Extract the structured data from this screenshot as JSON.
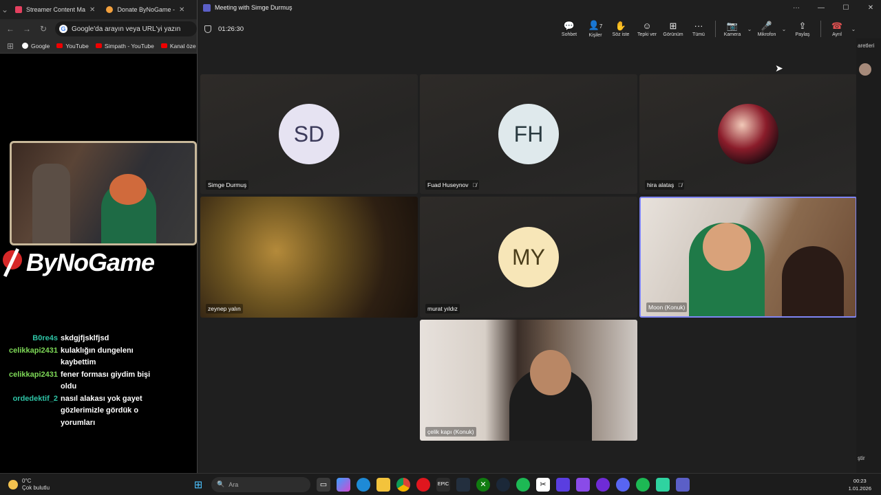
{
  "browser": {
    "tabs": [
      {
        "label": "Streamer Content Ma",
        "color": "#e4405f"
      },
      {
        "label": "Donate ByNoGame -",
        "color": "#f2a03d"
      }
    ],
    "url_placeholder": "Google'da arayın veya URL'yi yazın",
    "bookmarks": [
      "Google",
      "YouTube",
      "Simpath - YouTube",
      "Kanal öze"
    ]
  },
  "overlay": {
    "brand": "ByNoGame",
    "chat": [
      {
        "user": "B0re4s",
        "msg": "skdgjfjsklfjsd",
        "color": "#2ec4a6"
      },
      {
        "user": "celikkapi2431",
        "msg": "kulaklığın dungelenı kaybettim",
        "color": "#7ed957"
      },
      {
        "user": "celikkapi2431",
        "msg": "fener forması giydim bişi oldu",
        "color": "#7ed957"
      },
      {
        "user": "ordedektif_2",
        "msg": "nasıl alakası yok gayet gözlerimizle gördük o yorumları",
        "color": "#2ec4a6"
      }
    ]
  },
  "meeting": {
    "title": "Meeting with Simge Durmuş",
    "timer": "01:26:30",
    "toolbar": {
      "chat": "Sohbet",
      "people": "Kişiler",
      "people_count": "7",
      "raise_hand": "Söz iste",
      "react": "Tepki ver",
      "view": "Görünüm",
      "more": "Tümü",
      "camera": "Kamera",
      "mic": "Mikrofon",
      "share": "Paylaş",
      "leave": "Ayrıl"
    },
    "participants": [
      {
        "name": "Simge Durmuş",
        "initials": "SD",
        "avatar_color": "#e6e3f2"
      },
      {
        "name": "Fuad Huseynov",
        "initials": "FH",
        "avatar_color": "#dfe9ec"
      },
      {
        "name": "hira alataş"
      },
      {
        "name": "zeynep yalın"
      },
      {
        "name": "murat yıldız",
        "initials": "MY",
        "avatar_color": "#f7e6b8"
      },
      {
        "name": "Moon (Konuk)"
      },
      {
        "name": "çelik kapı (Konuk)"
      }
    ],
    "edge_text_top": "aretleri",
    "edge_text_bottom": "ştir"
  },
  "taskbar": {
    "temp": "0°C",
    "weather": "Çok bulutlu",
    "search_placeholder": "Ara",
    "time": "00:23",
    "date": "1.01.2026"
  }
}
